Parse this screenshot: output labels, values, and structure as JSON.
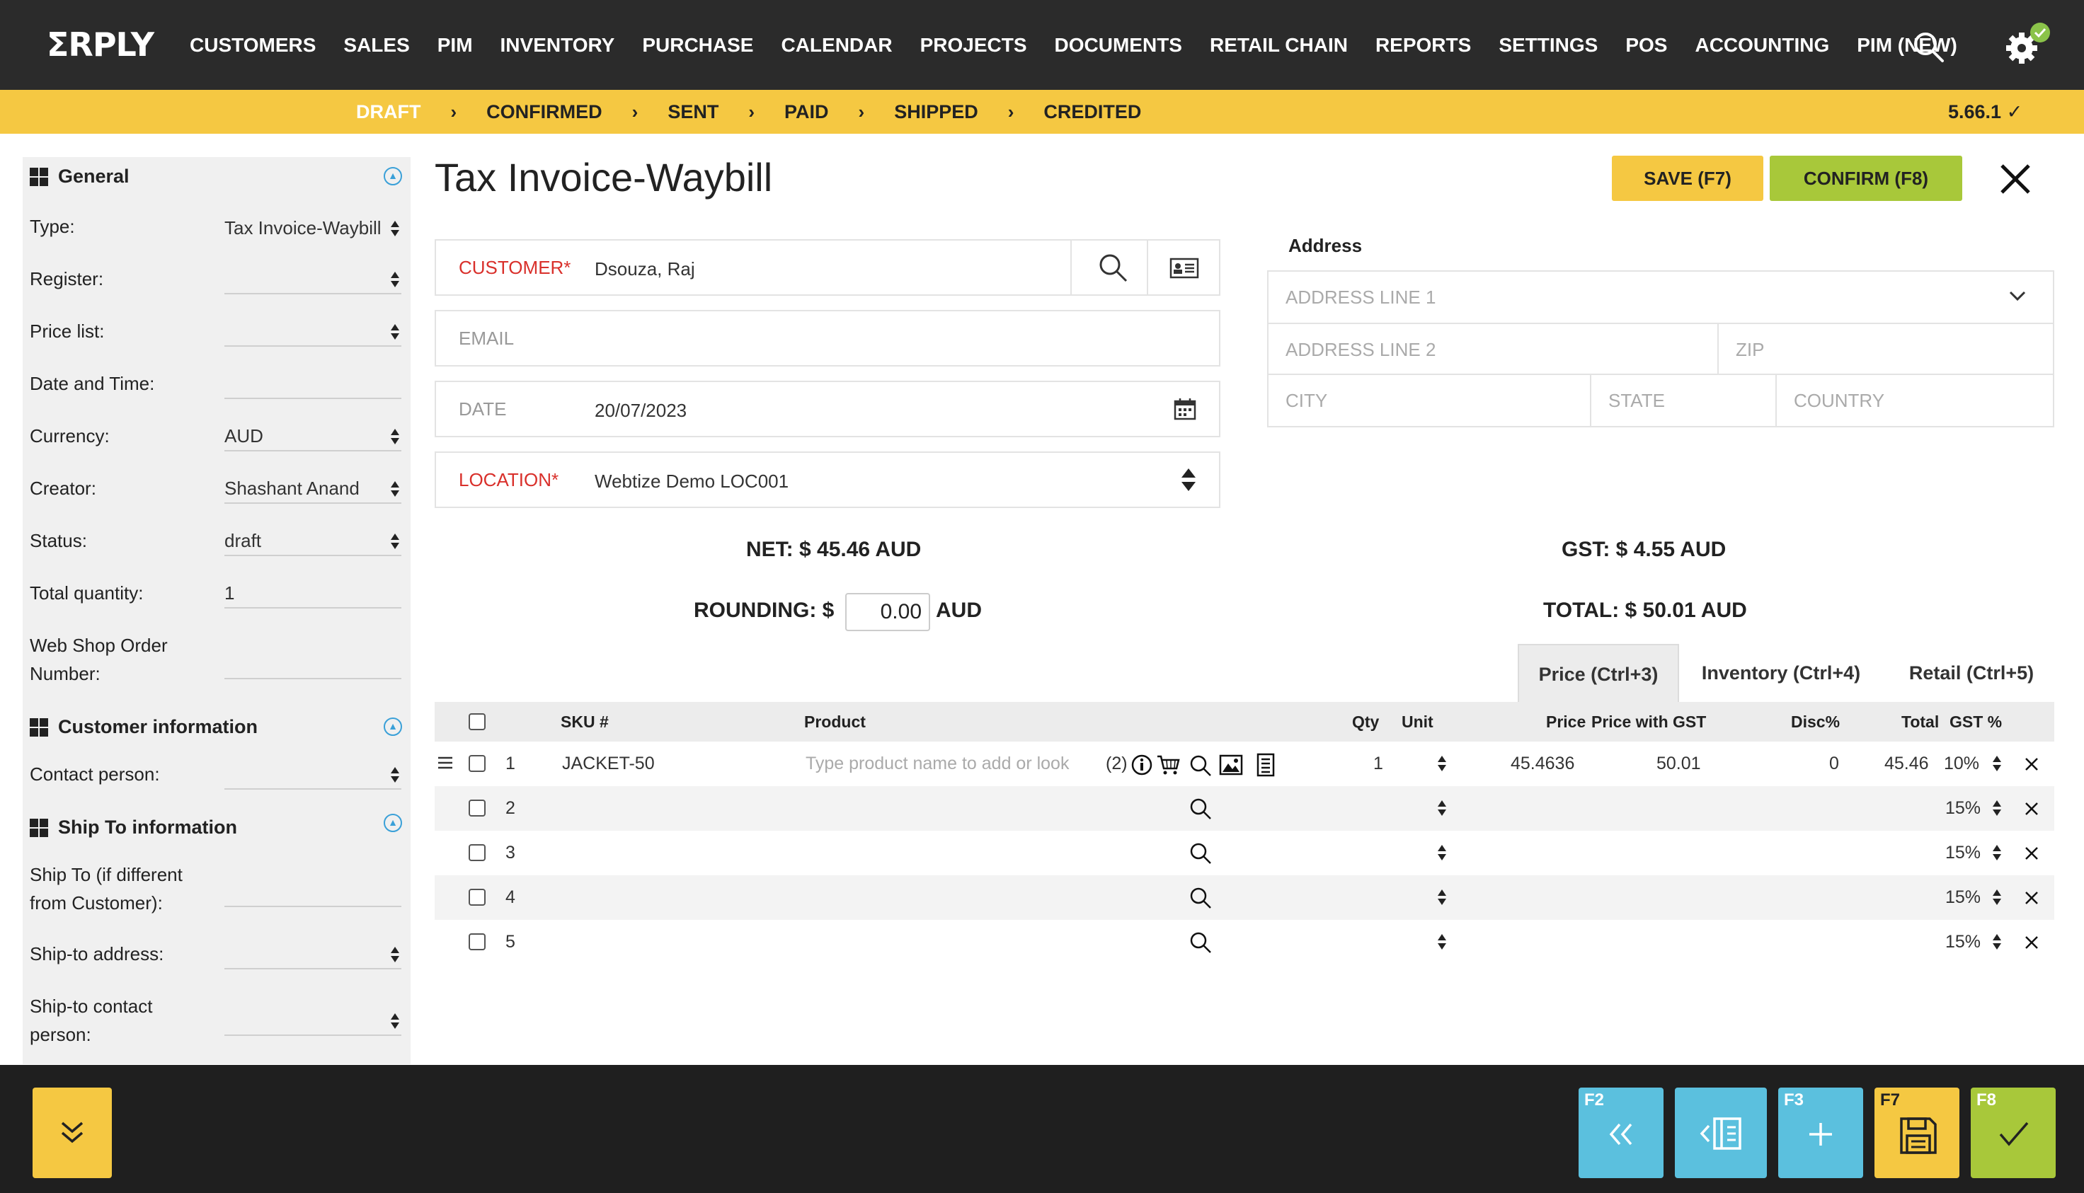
{
  "app": {
    "logo": "ΣRPLY"
  },
  "nav": {
    "items": [
      "CUSTOMERS",
      "SALES",
      "PIM",
      "INVENTORY",
      "PURCHASE",
      "CALENDAR",
      "PROJECTS",
      "DOCUMENTS",
      "RETAIL CHAIN",
      "REPORTS",
      "SETTINGS",
      "POS",
      "ACCOUNTING",
      "PIM (NEW)"
    ]
  },
  "status": {
    "steps": [
      "DRAFT",
      "CONFIRMED",
      "SENT",
      "PAID",
      "SHIPPED",
      "CREDITED"
    ],
    "active": "DRAFT",
    "separator": "›",
    "version": "5.66.1 ✓"
  },
  "sidebar": {
    "general": {
      "title": "General",
      "type_label": "Type:",
      "type_value": "Tax Invoice-Waybill",
      "register_label": "Register:",
      "register_value": "",
      "pricelist_label": "Price list:",
      "pricelist_value": "",
      "datetime_label": "Date and Time:",
      "datetime_value": "",
      "currency_label": "Currency:",
      "currency_value": "AUD",
      "creator_label": "Creator:",
      "creator_value": "Shashant Anand",
      "status_label": "Status:",
      "status_value": "draft",
      "totalqty_label": "Total quantity:",
      "totalqty_value": "1",
      "webshop_label_1": "Web Shop Order",
      "webshop_label_2": "Number:",
      "webshop_value": ""
    },
    "customer": {
      "title": "Customer information",
      "contact_label": "Contact person:",
      "contact_value": ""
    },
    "shipto": {
      "title": "Ship To information",
      "shipto_label_1": "Ship To (if different",
      "shipto_label_2": "from Customer):",
      "address_label": "Ship-to address:",
      "contact_label_1": "Ship-to contact",
      "contact_label_2": "person:"
    }
  },
  "header": {
    "title": "Tax Invoice-Waybill",
    "save_label": "SAVE (F7)",
    "confirm_label": "CONFIRM (F8)"
  },
  "form": {
    "customer_label": "CUSTOMER*",
    "customer_value": "Dsouza, Raj",
    "email_placeholder": "EMAIL",
    "date_label": "DATE",
    "date_value": "20/07/2023",
    "location_label": "LOCATION*",
    "location_value": "Webtize Demo LOC001"
  },
  "address": {
    "title": "Address",
    "line1": "ADDRESS LINE 1",
    "line2": "ADDRESS LINE 2",
    "zip": "ZIP",
    "city": "CITY",
    "state": "STATE",
    "country": "COUNTRY"
  },
  "totals": {
    "net": "NET: $ 45.46 AUD",
    "gst": "GST: $ 4.55 AUD",
    "rounding_label": "ROUNDING: $",
    "rounding_value": "0.00",
    "rounding_unit": "AUD",
    "total": "TOTAL: $ 50.01 AUD"
  },
  "tabs": [
    "Price (Ctrl+3)",
    "Inventory (Ctrl+4)",
    "Retail (Ctrl+5)"
  ],
  "table": {
    "headers": {
      "sku": "SKU #",
      "product": "Product",
      "qty": "Qty",
      "unit": "Unit",
      "price": "Price",
      "price_gst": "Price with GST",
      "disc": "Disc%",
      "total": "Total",
      "gst": "GST %"
    },
    "row1": {
      "num": "1",
      "sku": "JACKET-50",
      "product_placeholder": "Type product name to add or look",
      "count": "(2)",
      "qty": "1",
      "price": "45.4636",
      "price_gst": "50.01",
      "disc": "0",
      "total": "45.46",
      "gst": "10%"
    },
    "empty_rows": [
      {
        "num": "2",
        "gst": "15%"
      },
      {
        "num": "3",
        "gst": "15%"
      },
      {
        "num": "4",
        "gst": "15%"
      },
      {
        "num": "5",
        "gst": "15%"
      }
    ]
  },
  "footer": {
    "keys": [
      "F2",
      "F3",
      "F7",
      "F8"
    ],
    "colors": {
      "blue": "#5bc0de",
      "yellow": "#f5c842",
      "green": "#a8c83a"
    }
  }
}
